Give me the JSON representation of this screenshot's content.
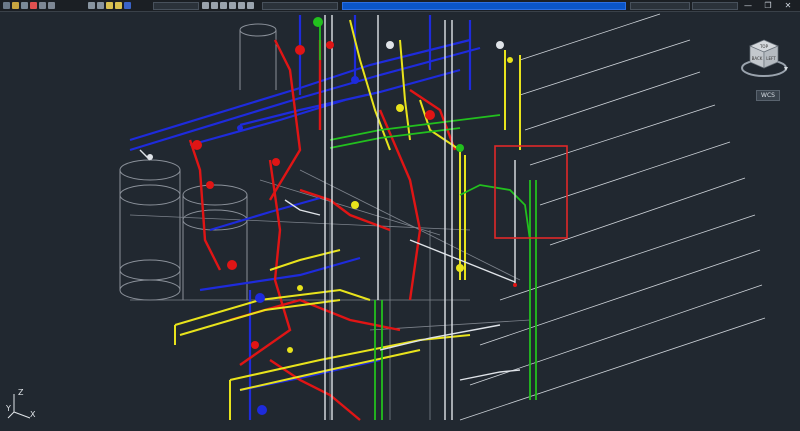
{
  "window": {
    "minimize_glyph": "—",
    "restore_glyph": "❐",
    "close_glyph": "✕"
  },
  "viewcube": {
    "face_top": "TOP",
    "face_left": "LEFT",
    "face_back": "BACK",
    "wcs_label": "WCS"
  },
  "ucs": {
    "x_label": "X",
    "y_label": "Y",
    "z_label": "Z"
  },
  "colors": {
    "background": "#212830",
    "pipe_blue": "#1e2bdc",
    "pipe_red": "#e01515",
    "pipe_yellow": "#e8e31c",
    "pipe_green": "#22c01e",
    "pipe_white": "#dfe3e8",
    "steel_gray": "#8a9099",
    "highlight_box": "#e02828"
  },
  "icons": [
    "qat-icons",
    "layer-dropdown",
    "viewcube-icon",
    "ucs-icon",
    "wcs-dropdown"
  ]
}
